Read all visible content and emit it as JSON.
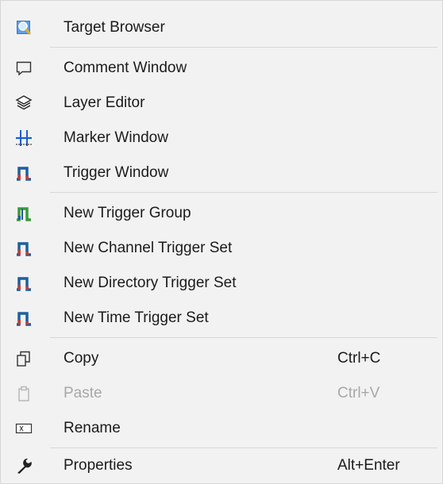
{
  "menu": {
    "items": [
      {
        "label": "Target Browser",
        "icon": "target-browser-icon",
        "shortcut": ""
      },
      {
        "label": "Comment Window",
        "icon": "comment-icon",
        "shortcut": ""
      },
      {
        "label": "Layer Editor",
        "icon": "layers-icon",
        "shortcut": ""
      },
      {
        "label": "Marker Window",
        "icon": "marker-grid-icon",
        "shortcut": ""
      },
      {
        "label": "Trigger Window",
        "icon": "trigger-icon",
        "shortcut": ""
      },
      {
        "label": "New Trigger Group",
        "icon": "trigger-group-icon",
        "shortcut": ""
      },
      {
        "label": "New Channel Trigger Set",
        "icon": "trigger-icon",
        "shortcut": ""
      },
      {
        "label": "New Directory Trigger Set",
        "icon": "trigger-icon",
        "shortcut": ""
      },
      {
        "label": "New Time Trigger Set",
        "icon": "trigger-icon",
        "shortcut": ""
      },
      {
        "label": "Copy",
        "icon": "copy-icon",
        "shortcut": "Ctrl+C"
      },
      {
        "label": "Paste",
        "icon": "paste-icon",
        "shortcut": "Ctrl+V",
        "disabled": true
      },
      {
        "label": "Rename",
        "icon": "rename-icon",
        "shortcut": ""
      },
      {
        "label": "Properties",
        "icon": "wrench-icon",
        "shortcut": "Alt+Enter"
      }
    ]
  },
  "colors": {
    "menu_background": "#f2f2f2",
    "text": "#1b1b1b",
    "disabled_text": "#a8a8a8",
    "separator": "#d7d7d7",
    "trigger_blue": "#1f5e9c",
    "trigger_red": "#d23a2a",
    "trigger_group_green": "#3a9a3a"
  }
}
